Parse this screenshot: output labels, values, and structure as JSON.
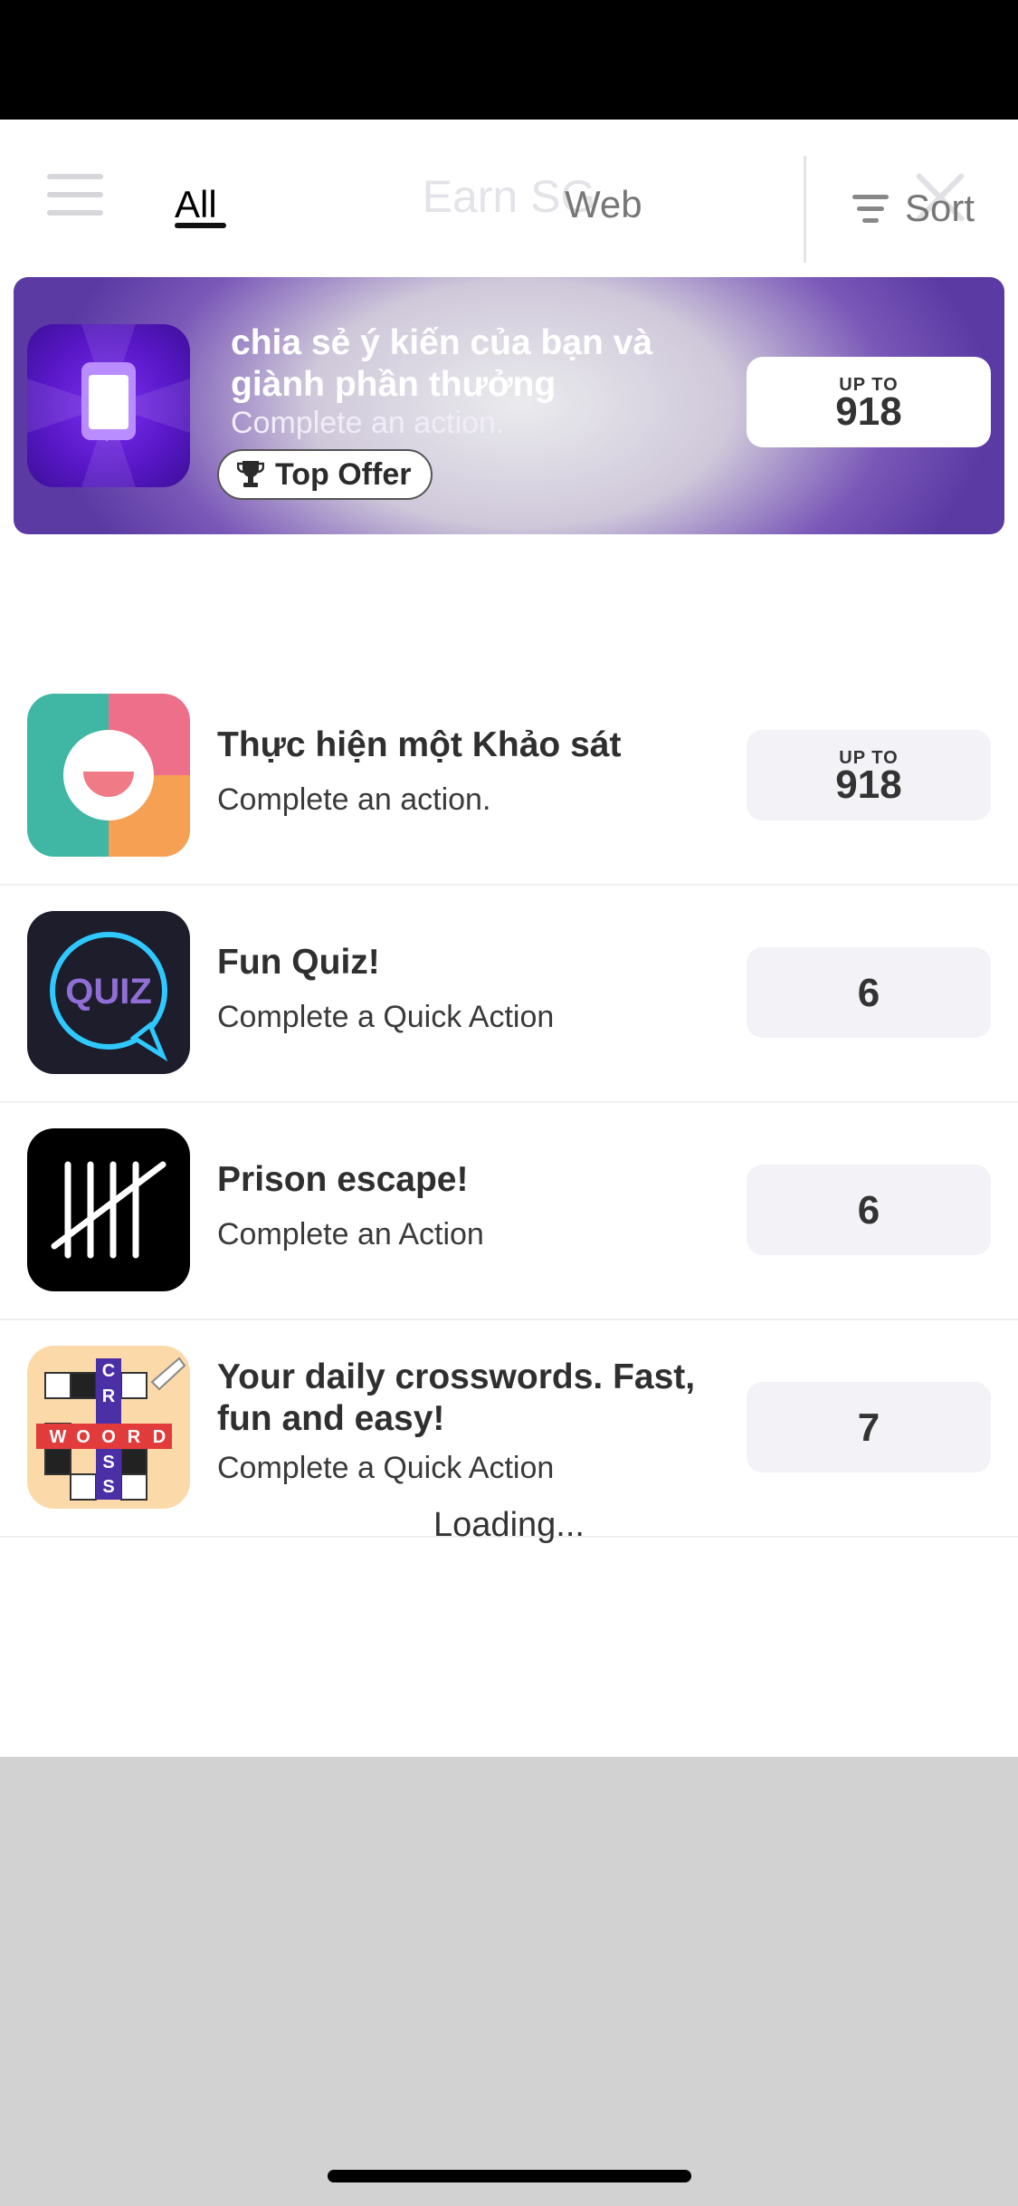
{
  "header": {
    "title": "Earn SG"
  },
  "tabs": [
    {
      "label": "All"
    },
    {
      "label": "Web"
    }
  ],
  "sort": {
    "label": "Sort"
  },
  "featured": {
    "title": "chia sẻ ý kiến của bạn và giành phần thưởng",
    "subtitle": "Complete an action.",
    "badge": "Top Offer",
    "reward_prefix": "UP TO",
    "reward": "918"
  },
  "offers": [
    {
      "title": "Thực hiện một Khảo sát",
      "subtitle": "Complete an action.",
      "reward_prefix": "UP TO",
      "reward": "918"
    },
    {
      "title": "Fun Quiz!",
      "subtitle": "Complete a Quick Action",
      "reward": "6"
    },
    {
      "title": "Prison escape!",
      "subtitle": "Complete an Action",
      "reward": "6"
    },
    {
      "title": "Your daily crosswords. Fast, fun and easy!",
      "subtitle": "Complete a Quick Action",
      "reward": "7"
    }
  ],
  "loading_text": "Loading...",
  "colors": {
    "accent": "#5b3aa4",
    "reward_bg": "#f2f2f7"
  }
}
